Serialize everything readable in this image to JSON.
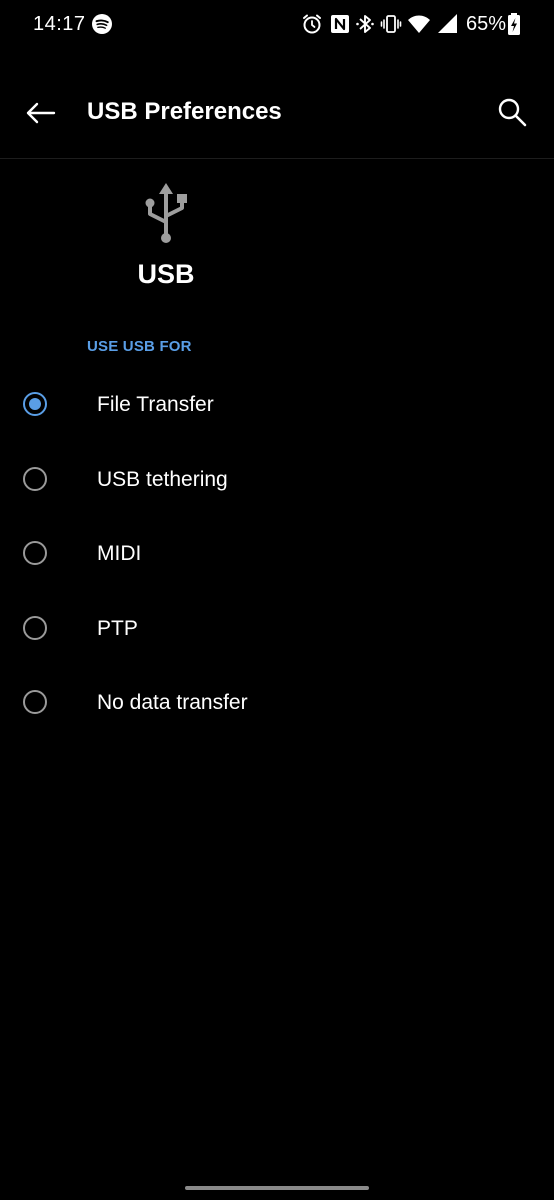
{
  "status_bar": {
    "time": "14:17",
    "battery_percent": "65%",
    "icons": [
      "spotify-icon",
      "alarm-icon",
      "nfc-icon",
      "bluetooth-icon",
      "vibrate-icon",
      "wifi-icon",
      "cellular-signal-icon",
      "battery-charging-icon"
    ]
  },
  "app_bar": {
    "title": "USB Preferences",
    "back_icon": "arrow-left-icon",
    "search_icon": "search-icon"
  },
  "header": {
    "icon": "usb-icon",
    "title": "USB"
  },
  "section": {
    "header": "USE USB FOR"
  },
  "options": [
    {
      "label": "File Transfer",
      "selected": true
    },
    {
      "label": "USB tethering",
      "selected": false
    },
    {
      "label": "MIDI",
      "selected": false
    },
    {
      "label": "PTP",
      "selected": false
    },
    {
      "label": "No data transfer",
      "selected": false
    }
  ],
  "colors": {
    "background": "#000000",
    "accent": "#5a9ee6",
    "text_primary": "#ffffff",
    "radio_unselected": "#9a9a9a"
  }
}
